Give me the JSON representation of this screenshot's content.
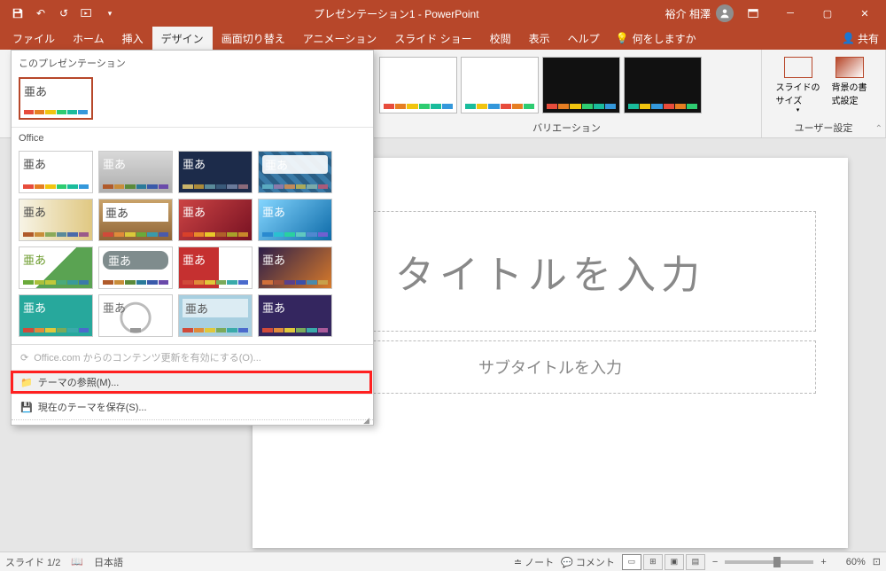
{
  "title": "プレゼンテーション1 - PowerPoint",
  "user": "裕介 相澤",
  "tabs": [
    "ファイル",
    "ホーム",
    "挿入",
    "デザイン",
    "画面切り替え",
    "アニメーション",
    "スライド ショー",
    "校閲",
    "表示",
    "ヘルプ"
  ],
  "active_tab_index": 3,
  "tell_me": "何をしますか",
  "share": "共有",
  "themes": {
    "section_this": "このプレゼンテーション",
    "section_office": "Office",
    "office_com_cmd": "Office.com からのコンテンツ更新を有効にする(O)...",
    "browse_cmd": "テーマの参照(M)...",
    "save_cmd": "現在のテーマを保存(S)...",
    "thumb_text": "亜あ"
  },
  "variation_label": "バリエーション",
  "customize": {
    "slide_size": "スライドの\nサイズ",
    "format_bg": "背景の書\n式設定",
    "group_label": "ユーザー設定"
  },
  "slide": {
    "title_placeholder": "タイトルを入力",
    "subtitle_placeholder": "サブタイトルを入力"
  },
  "status": {
    "slide_indicator": "スライド 1/2",
    "language": "日本語",
    "notes": "ノート",
    "comments": "コメント",
    "zoom": "60%"
  },
  "palette_basic": [
    "#e74c3c",
    "#e67e22",
    "#f1c40f",
    "#2ecc71",
    "#1abc9c",
    "#3498db"
  ]
}
